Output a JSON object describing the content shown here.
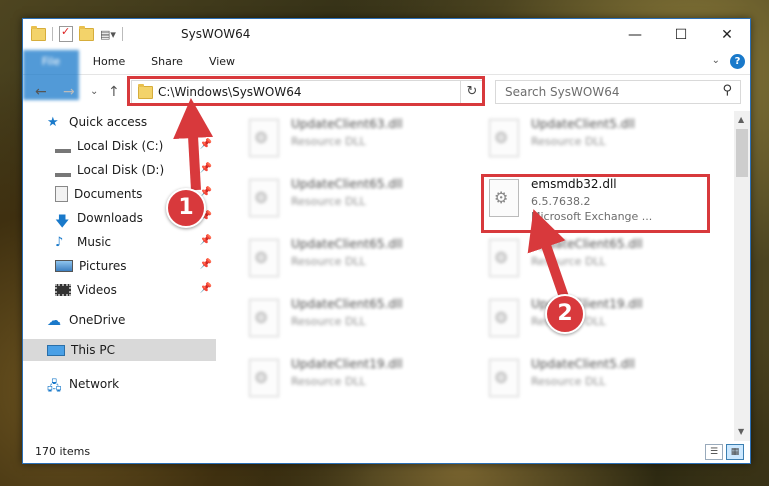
{
  "window": {
    "title": "SysWOW64",
    "controls": {
      "minimize": "—",
      "maximize": "☐",
      "close": "✕"
    }
  },
  "ribbon": {
    "tabs": [
      "File",
      "Home",
      "Share",
      "View"
    ],
    "help": "?"
  },
  "address": {
    "path": "C:\\Windows\\SysWOW64"
  },
  "search": {
    "placeholder": "Search SysWOW64"
  },
  "nav": {
    "items": [
      {
        "label": "Quick access",
        "icon": "star-icon"
      },
      {
        "label": "Local Disk (C:)",
        "icon": "drive-icon",
        "pinned": true
      },
      {
        "label": "Local Disk (D:)",
        "icon": "drive-icon",
        "pinned": true
      },
      {
        "label": "Documents",
        "icon": "documents-icon",
        "pinned": true
      },
      {
        "label": "Downloads",
        "icon": "download-icon",
        "pinned": true
      },
      {
        "label": "Music",
        "icon": "music-icon",
        "pinned": true
      },
      {
        "label": "Pictures",
        "icon": "pictures-icon",
        "pinned": true
      },
      {
        "label": "Videos",
        "icon": "videos-icon",
        "pinned": true
      },
      {
        "label": "OneDrive",
        "icon": "cloud-icon"
      },
      {
        "label": "This PC",
        "icon": "pc-icon",
        "selected": true
      },
      {
        "label": "Network",
        "icon": "network-icon"
      }
    ]
  },
  "files": [
    {
      "name": "UpdateClient63.dll",
      "meta": "Resource DLL"
    },
    {
      "name": "UpdateClient5.dll",
      "meta": "Resource DLL"
    },
    {
      "name": "UpdateClient65.dll",
      "meta": "Resource DLL"
    },
    {
      "name": "emsmdb32.dll",
      "meta": "6.5.7638.2",
      "meta2": "Microsoft Exchange ...",
      "highlight": true
    },
    {
      "name": "UpdateClient65.dll",
      "meta": "Resource DLL"
    },
    {
      "name": "UpdateClient65.dll",
      "meta": "Resource DLL"
    },
    {
      "name": "UpdateClient65.dll",
      "meta": "Resource DLL"
    },
    {
      "name": "UpdateClient19.dll",
      "meta": "Resource DLL"
    },
    {
      "name": "UpdateClient19.dll",
      "meta": "Resource DLL"
    },
    {
      "name": "UpdateClient5.dll",
      "meta": "Resource DLL"
    }
  ],
  "status": {
    "count": "170 items"
  },
  "annotations": {
    "badge1": "1",
    "badge2": "2",
    "color": "#d8393c"
  }
}
